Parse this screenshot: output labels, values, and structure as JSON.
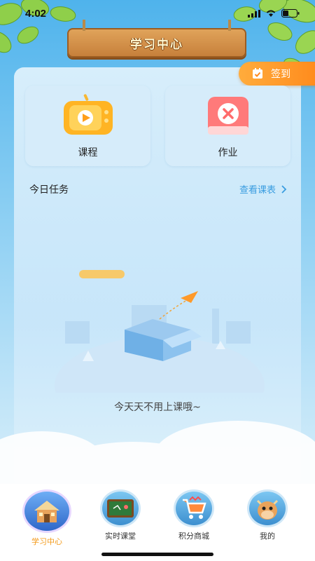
{
  "status": {
    "time": "4:02"
  },
  "header": {
    "title": "学习中心"
  },
  "signin": {
    "label": "签到"
  },
  "cards": [
    {
      "label": "课程",
      "icon": "tv-play-icon"
    },
    {
      "label": "作业",
      "icon": "homework-book-icon"
    }
  ],
  "tasks": {
    "title": "今日任务",
    "link": "查看课表",
    "empty": "今天天不用上课哦~"
  },
  "tabs": [
    {
      "label": "学习中心",
      "icon": "school-house-icon",
      "active": true
    },
    {
      "label": "实时课堂",
      "icon": "blackboard-icon",
      "active": false
    },
    {
      "label": "积分商城",
      "icon": "shopping-cart-icon",
      "active": false
    },
    {
      "label": "我的",
      "icon": "cartoon-cow-icon",
      "active": false
    }
  ],
  "colors": {
    "accent": "#ff9a2a",
    "link": "#3a9de0",
    "active_tab": "#f39a1a"
  }
}
